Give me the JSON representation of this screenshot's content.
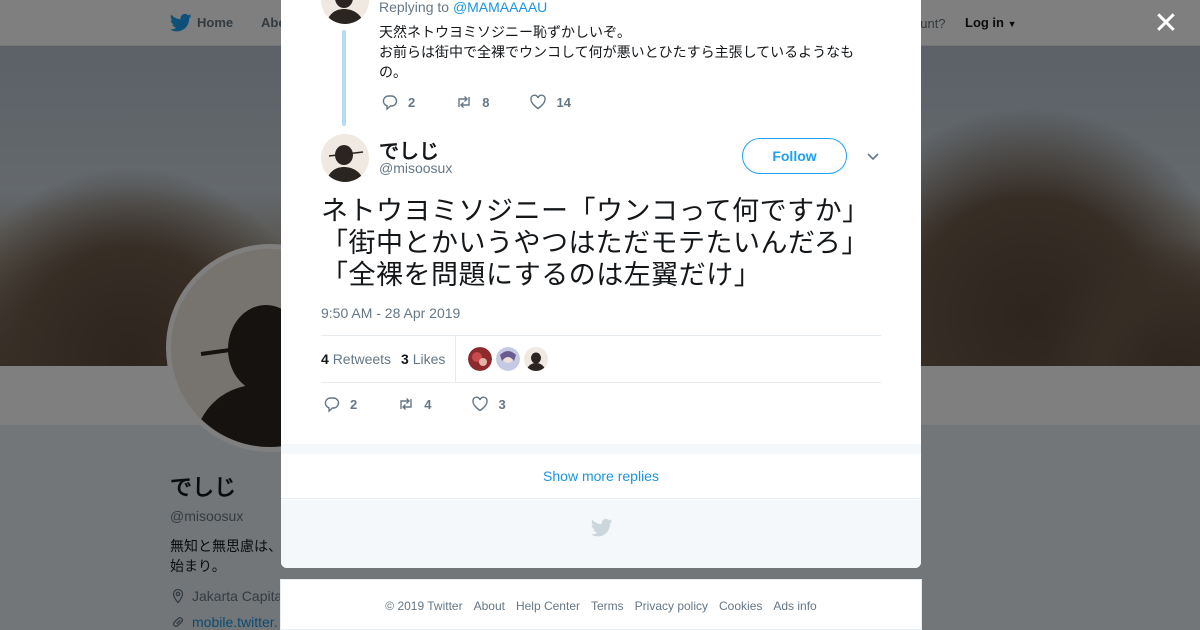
{
  "nav": {
    "home": "Home",
    "about": "Abo",
    "account_prompt": "ccount?",
    "login": "Log in"
  },
  "profile": {
    "name": "でしじ",
    "handle": "@misoosux",
    "bio": "無知と無思慮は、始まり。",
    "location": "Jakarta Capita",
    "link": "mobile.twitter."
  },
  "parent_tweet": {
    "replying_prefix": "Replying to",
    "replying_to": "@MAMAAAAU",
    "text_line1": "天然ネトウヨミソジニー恥ずかしいぞ。",
    "text_line2": "お前らは街中で全裸でウンコして何が悪いとひたすら主張しているようなもの。",
    "replies": "2",
    "retweets": "8",
    "likes": "14"
  },
  "main_tweet": {
    "name": "でしじ",
    "handle": "@misoosux",
    "follow_label": "Follow",
    "text": "ネトウヨミソジニー「ウンコって何ですか」「街中とかいうやつはただモテたいんだろ」「全裸を問題にするのは左翼だけ」",
    "timestamp": "9:50 AM - 28 Apr 2019",
    "retweet_count": "4",
    "retweet_label": "Retweets",
    "like_count": "3",
    "like_label": "Likes",
    "replies": "2",
    "retweets": "4",
    "likes": "3"
  },
  "show_more": "Show more replies",
  "footer": {
    "links": [
      "© 2019 Twitter",
      "About",
      "Help Center",
      "Terms",
      "Privacy policy",
      "Cookies",
      "Ads info"
    ]
  },
  "colors": {
    "brand": "#1da1f2",
    "link": "#1b95e0",
    "muted": "#657786",
    "thread_line": "#b5dcf5"
  },
  "icons": [
    "twitter-bird-icon",
    "close-icon",
    "reply-icon",
    "retweet-icon",
    "heart-icon",
    "chevron-down-icon",
    "location-icon",
    "link-icon"
  ]
}
